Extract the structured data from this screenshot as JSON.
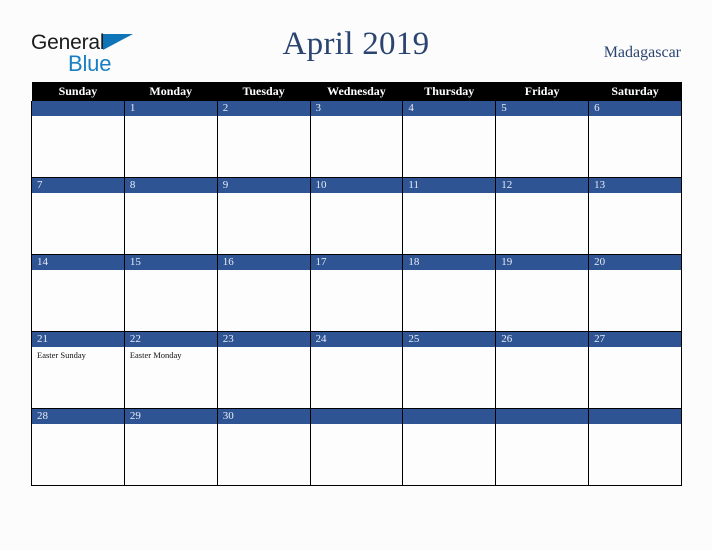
{
  "logo": {
    "word1": "General",
    "word2": "Blue",
    "triangle_color": "#1074b9",
    "word2_color": "#1a7fc1"
  },
  "header": {
    "title": "April 2019",
    "region": "Madagascar",
    "title_color": "#2b4570"
  },
  "calendar": {
    "month": "April",
    "year": "2019",
    "accent_color": "#2e5494",
    "header_bg": "#000000",
    "weekday_headers": [
      "Sunday",
      "Monday",
      "Tuesday",
      "Wednesday",
      "Thursday",
      "Friday",
      "Saturday"
    ],
    "weeks": [
      [
        {
          "day": "",
          "events": []
        },
        {
          "day": "1",
          "events": []
        },
        {
          "day": "2",
          "events": []
        },
        {
          "day": "3",
          "events": []
        },
        {
          "day": "4",
          "events": []
        },
        {
          "day": "5",
          "events": []
        },
        {
          "day": "6",
          "events": []
        }
      ],
      [
        {
          "day": "7",
          "events": []
        },
        {
          "day": "8",
          "events": []
        },
        {
          "day": "9",
          "events": []
        },
        {
          "day": "10",
          "events": []
        },
        {
          "day": "11",
          "events": []
        },
        {
          "day": "12",
          "events": []
        },
        {
          "day": "13",
          "events": []
        }
      ],
      [
        {
          "day": "14",
          "events": []
        },
        {
          "day": "15",
          "events": []
        },
        {
          "day": "16",
          "events": []
        },
        {
          "day": "17",
          "events": []
        },
        {
          "day": "18",
          "events": []
        },
        {
          "day": "19",
          "events": []
        },
        {
          "day": "20",
          "events": []
        }
      ],
      [
        {
          "day": "21",
          "events": [
            "Easter Sunday"
          ]
        },
        {
          "day": "22",
          "events": [
            "Easter Monday"
          ]
        },
        {
          "day": "23",
          "events": []
        },
        {
          "day": "24",
          "events": []
        },
        {
          "day": "25",
          "events": []
        },
        {
          "day": "26",
          "events": []
        },
        {
          "day": "27",
          "events": []
        }
      ],
      [
        {
          "day": "28",
          "events": []
        },
        {
          "day": "29",
          "events": []
        },
        {
          "day": "30",
          "events": []
        },
        {
          "day": "",
          "events": []
        },
        {
          "day": "",
          "events": []
        },
        {
          "day": "",
          "events": []
        },
        {
          "day": "",
          "events": []
        }
      ]
    ]
  }
}
